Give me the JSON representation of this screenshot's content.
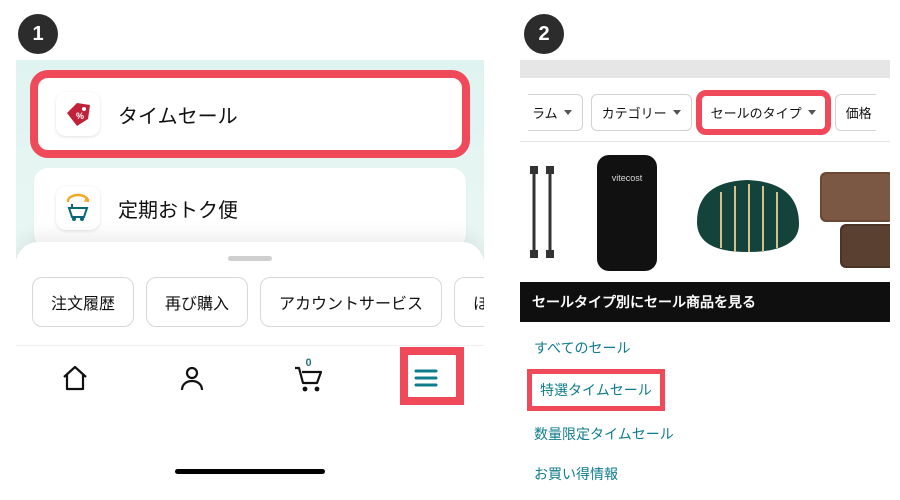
{
  "steps": {
    "one": "1",
    "two": "2"
  },
  "left": {
    "menu": {
      "timesale": "タイムセール",
      "subscribe": "定期おトク便"
    },
    "chips": {
      "orders": "注文履歴",
      "buy_again": "再び購入",
      "account": "アカウントサービス",
      "more": "ほ"
    },
    "cart_count": "0",
    "icons": {
      "tag": "tag-percent-icon",
      "subscribe": "subscribe-save-icon",
      "home": "home-icon",
      "user": "user-icon",
      "cart": "cart-icon",
      "hamburger": "hamburger-icon"
    }
  },
  "right": {
    "filters": {
      "program_partial": "ラム",
      "category": "カテゴリー",
      "sale_type": "セールのタイプ",
      "price_partial": "価格"
    },
    "darkbar": "セールタイプ別にセール商品を見る",
    "links": {
      "all": "すべてのセール",
      "special": "特選タイムセール",
      "limited": "数量限定タイムセール",
      "bargain": "お買い得情報"
    }
  }
}
